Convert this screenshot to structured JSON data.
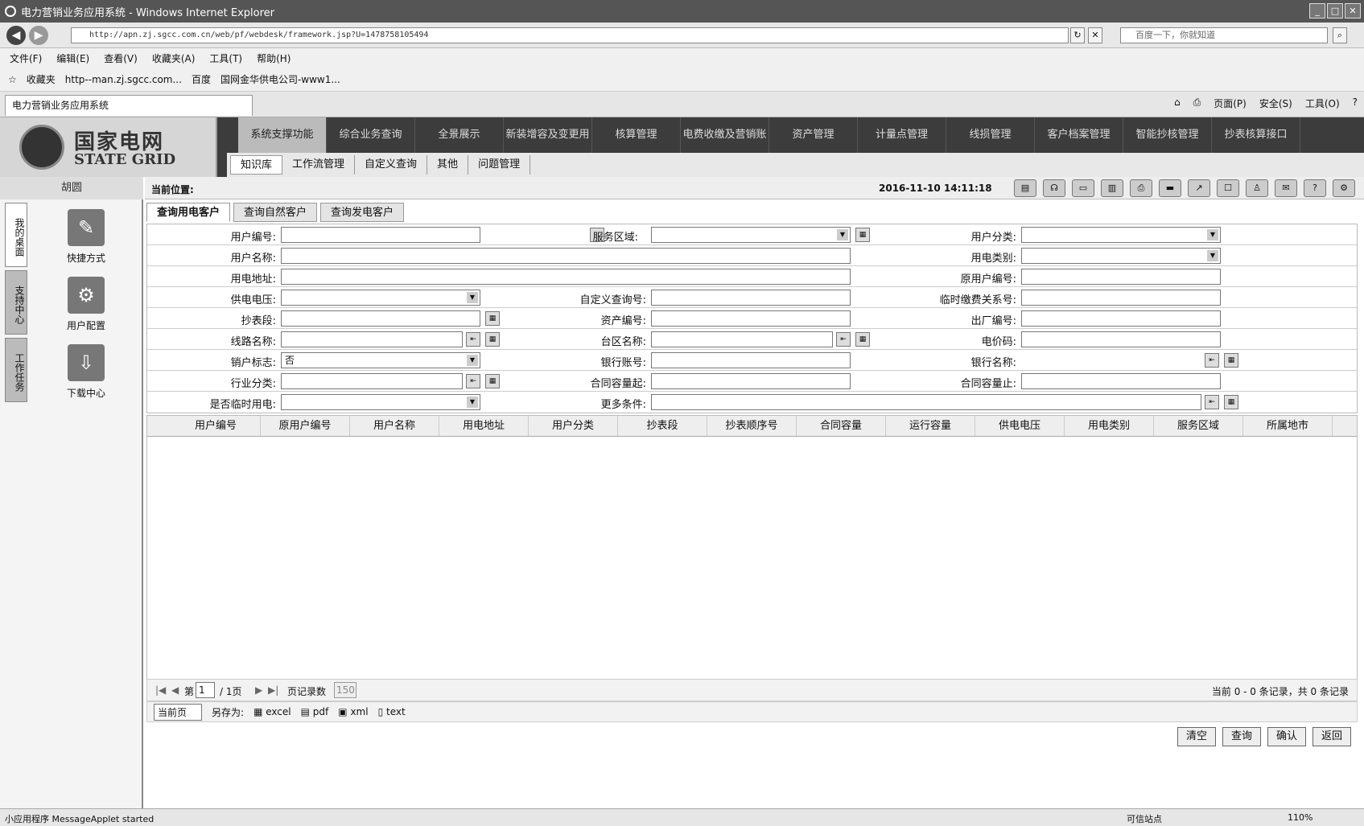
{
  "window": {
    "title": "电力营销业务应用系统 - Windows Internet Explorer",
    "url": "http://apn.zj.sgcc.com.cn/web/pf/webdesk/framework.jsp?U=1478758105494",
    "search_placeholder": "百度一下，你就知道"
  },
  "menubar": [
    "文件(F)",
    "编辑(E)",
    "查看(V)",
    "收藏夹(A)",
    "工具(T)",
    "帮助(H)"
  ],
  "favorites": {
    "label": "收藏夹",
    "items": [
      "http--man.zj.sgcc.com...",
      "百度",
      "国网金华供电公司-www1..."
    ]
  },
  "page_tab": "电力营销业务应用系统",
  "ie_cmds": [
    "页面(P)",
    "安全(S)",
    "工具(O)"
  ],
  "logo": {
    "cn": "国家电网",
    "en": "STATE GRID"
  },
  "topnav": [
    "系统支撑功能",
    "综合业务查询",
    "全景展示",
    "新装增容及变更用",
    "核算管理",
    "电费收缴及营销账",
    "资产管理",
    "计量点管理",
    "线损管理",
    "客户档案管理",
    "智能抄核管理",
    "抄表核算接口"
  ],
  "subnav": [
    "知识库",
    "工作流管理",
    "自定义查询",
    "其他",
    "问题管理"
  ],
  "sidebar": {
    "header": "胡圆",
    "vtabs": [
      "我的桌面",
      "支持中心",
      "工作任务"
    ],
    "shortcuts": [
      "快捷方式",
      "用户配置",
      "下载中心"
    ]
  },
  "location": {
    "label": "当前位置:",
    "timestamp": "2016-11-10 14:11:18"
  },
  "subtabs": [
    "查询用电客户",
    "查询自然客户",
    "查询发电客户"
  ],
  "form": {
    "user_no": "用户编号:",
    "service_area": "服务区域:",
    "user_class": "用户分类:",
    "user_name": "用户名称:",
    "elec_type": "用电类别:",
    "elec_addr": "用电地址:",
    "orig_user_no": "原用户编号:",
    "supply_voltage": "供电电压:",
    "custom_query_no": "自定义查询号:",
    "temp_fee_rel": "临时缴费关系号:",
    "meter_section": "抄表段:",
    "asset_no": "资产编号:",
    "factory_no": "出厂编号:",
    "line_name": "线路名称:",
    "station_name": "台区名称:",
    "price_code": "电价码:",
    "cancel_flag": "销户标志:",
    "cancel_flag_value": "否",
    "bank_account": "银行账号:",
    "bank_name": "银行名称:",
    "industry": "行业分类:",
    "contract_cap_from": "合同容量起:",
    "contract_cap_to": "合同容量止:",
    "is_temp": "是否临时用电:",
    "more": "更多条件:"
  },
  "grid_headers": [
    "用户编号",
    "原用户编号",
    "用户名称",
    "用电地址",
    "用户分类",
    "抄表段",
    "抄表顺序号",
    "合同容量",
    "运行容量",
    "供电电压",
    "用电类别",
    "服务区域",
    "所属地市"
  ],
  "pager": {
    "page_label": "第",
    "page": "1",
    "total": "/ 1页",
    "rows_label": "页记录数",
    "rows": "150",
    "summary": "当前 0 - 0 条记录，共 0 条记录"
  },
  "export": {
    "scope": "当前页",
    "save_as": "另存为:",
    "formats": [
      "excel",
      "pdf",
      "xml",
      "text"
    ]
  },
  "buttons": [
    "清空",
    "查询",
    "确认",
    "返回"
  ],
  "status": {
    "left": "小应用程序 MessageApplet started",
    "trusted": "可信站点",
    "zoom": "110%"
  }
}
